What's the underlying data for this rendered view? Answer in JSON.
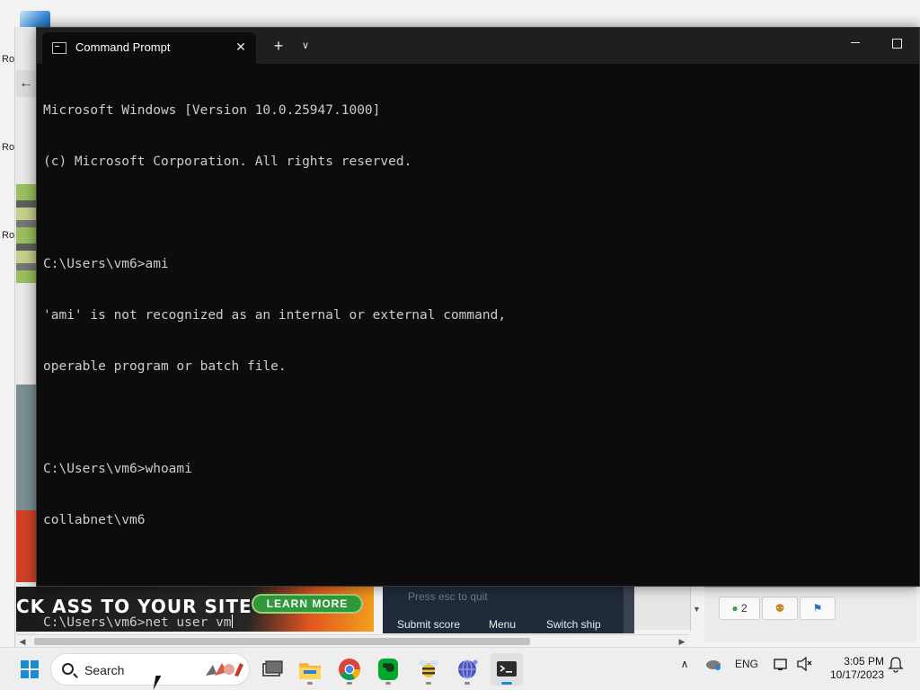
{
  "desktop": {
    "icon_labels": [
      "Ro",
      "Ro",
      "Ro"
    ]
  },
  "background_window": {
    "ad": {
      "text": "CK ASS TO YOUR SITE",
      "button": "LEARN MORE"
    },
    "game": {
      "hint": "Press esc to quit",
      "links": [
        "Submit score",
        "Menu",
        "Switch ship"
      ]
    },
    "chat": {
      "badge_count": "2"
    }
  },
  "terminal": {
    "tab_title": "Command Prompt",
    "new_tab_symbol": "+",
    "lines": [
      "Microsoft Windows [Version 10.0.25947.1000]",
      "(c) Microsoft Corporation. All rights reserved.",
      "",
      "C:\\Users\\vm6>ami",
      "'ami' is not recognized as an internal or external command,",
      "operable program or batch file.",
      "",
      "C:\\Users\\vm6>whoami",
      "collabnet\\vm6",
      ""
    ],
    "current_prompt": "C:\\Users\\vm6>",
    "current_input": "net user vm"
  },
  "taskbar": {
    "search_label": "Search",
    "pinned_apps": [
      {
        "icon": "task-view-icon",
        "label": "Task View"
      },
      {
        "icon": "file-explorer-icon",
        "label": "File Explorer"
      },
      {
        "icon": "chrome-icon",
        "label": "Google Chrome"
      },
      {
        "icon": "evernote-icon",
        "label": "Evernote"
      },
      {
        "icon": "bee-app-icon",
        "label": "App"
      },
      {
        "icon": "globe-app-icon",
        "label": "App"
      },
      {
        "icon": "terminal-icon",
        "label": "Terminal"
      }
    ],
    "tray": {
      "language": "ENG",
      "time": "3:05 PM",
      "date": "10/17/2023"
    }
  },
  "colors": {
    "terminal_bg": "#0c0c0c",
    "terminal_text": "#cccccc",
    "titlebar_bg": "#1f1f1f",
    "taskbar_bg": "#eeeeee",
    "accent": "#1a8ad4"
  }
}
